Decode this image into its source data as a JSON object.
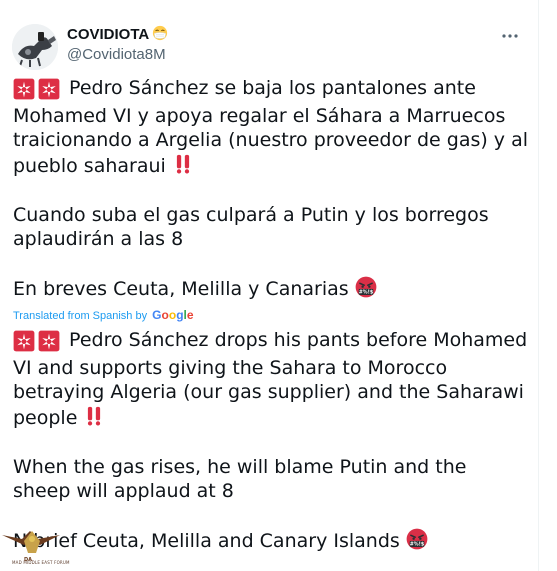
{
  "account": {
    "display_name": "COVIDIOTA",
    "name_emoji": "mask-face-icon",
    "handle": "@Covidiota8M"
  },
  "tweet": {
    "para1_text": " Pedro Sánchez se baja los pantalones ante Mohamed VI y apoya regalar el Sáhara a Marruecos traicionando a Argelia (nuestro proveedor de gas) y al pueblo saharaui ",
    "para2_text": "Cuando suba el gas culpará a Putin y los borregos aplaudirán a las 8",
    "para3_text": "En breves Ceuta, Melilla y Canarias "
  },
  "translation": {
    "label": "Translated from Spanish by",
    "provider": "Google",
    "para1_text": " Pedro Sánchez drops his pants before Mohamed VI and supports giving the Sahara to Morocco betraying Algeria (our gas supplier) and the Saharawi people ",
    "para2_text": " When the gas rises, he will blame Putin and the sheep will applaud at 8",
    "para3_prefix": "N",
    "para3_text": " brief Ceuta, Melilla and Canary Islands "
  },
  "icons": {
    "siren": "police-light-icon",
    "exclamation": "double-exclamation-icon",
    "angry": "cursing-face-icon",
    "more": "more-options-icon"
  },
  "colors": {
    "text": "#0f1419",
    "secondary": "#536471",
    "link": "#1d9bf0",
    "siren_red": "#dd2e44",
    "angry_red": "#da2f47"
  },
  "watermark": {
    "label": "MAD MIDDLE EAST FORUM"
  }
}
